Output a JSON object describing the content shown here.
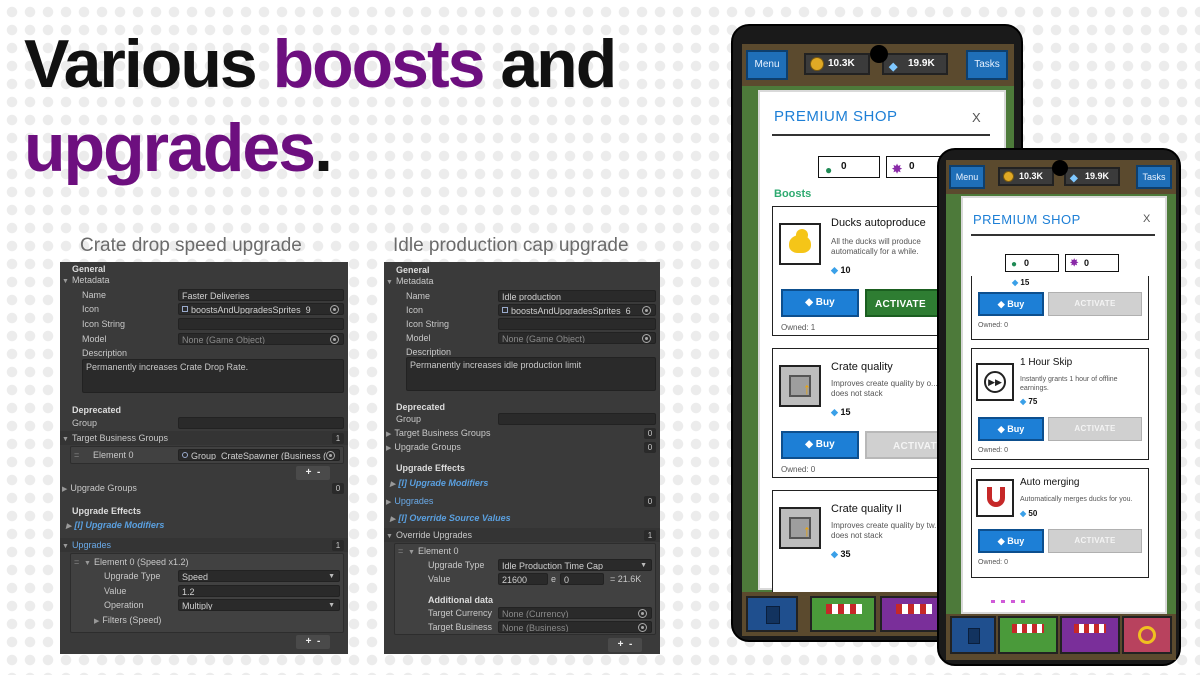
{
  "headline": {
    "part1": "Various ",
    "part2": "boosts",
    "part3": " and",
    "part4": "upgrades",
    "part5": "."
  },
  "captions": {
    "left": "Crate drop speed upgrade",
    "right": "Idle production cap upgrade"
  },
  "left_inspector": {
    "general": "General",
    "metadata": "Metadata",
    "name_label": "Name",
    "name_value": "Faster Deliveries",
    "icon_label": "Icon",
    "icon_value": "boostsAndUpgradesSprites_9",
    "icon_string_label": "Icon String",
    "model_label": "Model",
    "model_value": "None (Game Object)",
    "description_label": "Description",
    "description_value": "Permanently increases Crate Drop Rate.",
    "deprecated": "Deprecated",
    "group_label": "Group",
    "target_business_groups": "Target Business Groups",
    "target_business_groups_count": "1",
    "element0_label": "Element 0",
    "element0_value": "Group_CrateSpawner (Business (",
    "plus": "+",
    "minus": "-",
    "upgrade_groups": "Upgrade Groups",
    "upgrade_groups_count": "0",
    "upgrade_effects": "Upgrade Effects",
    "upgrade_modifiers": "[I]  Upgrade Modifiers",
    "upgrades": "Upgrades",
    "upgrades_count": "1",
    "element0_speed": "Element 0 (Speed x1.2)",
    "upgrade_type_label": "Upgrade Type",
    "upgrade_type_value": "Speed",
    "value_label": "Value",
    "value_value": "1.2",
    "operation_label": "Operation",
    "operation_value": "Multiply",
    "filters": "Filters (Speed)"
  },
  "right_inspector": {
    "general": "General",
    "metadata": "Metadata",
    "name_label": "Name",
    "name_value": "Idle production",
    "icon_label": "Icon",
    "icon_value": "boostsAndUpgradesSprites_6",
    "icon_string_label": "Icon String",
    "model_label": "Model",
    "model_value": "None (Game Object)",
    "description_label": "Description",
    "description_value": "Permanently increases idle production limit",
    "deprecated": "Deprecated",
    "group_label": "Group",
    "target_business_groups": "Target Business Groups",
    "target_business_groups_count": "0",
    "upgrade_groups": "Upgrade Groups",
    "upgrade_groups_count": "0",
    "upgrade_effects": "Upgrade Effects",
    "upgrade_modifiers": "[I]  Upgrade Modifiers",
    "upgrades": "Upgrades",
    "upgrades_count": "0",
    "override_source_values": "[I]  Override Source Values",
    "override_upgrades": "Override Upgrades",
    "override_upgrades_count": "1",
    "element0": "Element 0",
    "upgrade_type_label": "Upgrade Type",
    "upgrade_type_value": "Idle Production Time Cap",
    "value_label": "Value",
    "value_value": "21600",
    "value_e": "e",
    "value_exp": "0",
    "value_result": "= 21.6K",
    "additional_data": "Additional data",
    "target_currency_label": "Target Currency",
    "target_currency_value": "None (Currency)",
    "target_business_label": "Target Business",
    "target_business_value": "None (Business)",
    "plus": "+",
    "minus": "-"
  },
  "phone_back": {
    "menu": "Menu",
    "coins": "10.3K",
    "gems": "19.9K",
    "tasks": "Tasks",
    "title": "PREMIUM SHOP",
    "close": "X",
    "green_gems": "0",
    "purple_gems": "0",
    "boosts_label": "Boosts",
    "cards": [
      {
        "title": "Ducks autoproduce",
        "desc": "All the ducks will produce automatically for a while.",
        "price": "10",
        "buy": "Buy",
        "activate": "ACTIVATE",
        "owned": "Owned: 1"
      },
      {
        "title": "Crate quality",
        "desc": "Improves create quality by o... does not stack",
        "price": "15",
        "buy": "Buy",
        "activate": "ACTIVATE",
        "owned": "Owned: 0"
      },
      {
        "title": "Crate quality II",
        "desc": "Improves create quality by tw... does not stack",
        "price": "35"
      }
    ]
  },
  "phone_front": {
    "menu": "Menu",
    "coins": "10.3K",
    "gems": "19.9K",
    "tasks": "Tasks",
    "title": "PREMIUM SHOP",
    "close": "X",
    "green_gems": "0",
    "purple_gems": "0",
    "partial_price": "15",
    "partial_buy": "Buy",
    "partial_activate": "ACTIVATE",
    "partial_owned": "Owned: 0",
    "cards": [
      {
        "title": "1 Hour Skip",
        "desc": "Instantly grants 1 hour of offline earnings.",
        "price": "75",
        "buy": "Buy",
        "activate": "ACTIVATE",
        "owned": "Owned: 0"
      },
      {
        "title": "Auto merging",
        "desc": "Automatically merges ducks for you.",
        "price": "50",
        "buy": "Buy",
        "activate": "ACTIVATE",
        "owned": "Owned: 0"
      }
    ]
  },
  "colors": {
    "accent_purple": "#6d0f7f",
    "shop_blue": "#1d7fd6",
    "activate_green": "#2e7d32",
    "boosts_green": "#2eaa70"
  }
}
